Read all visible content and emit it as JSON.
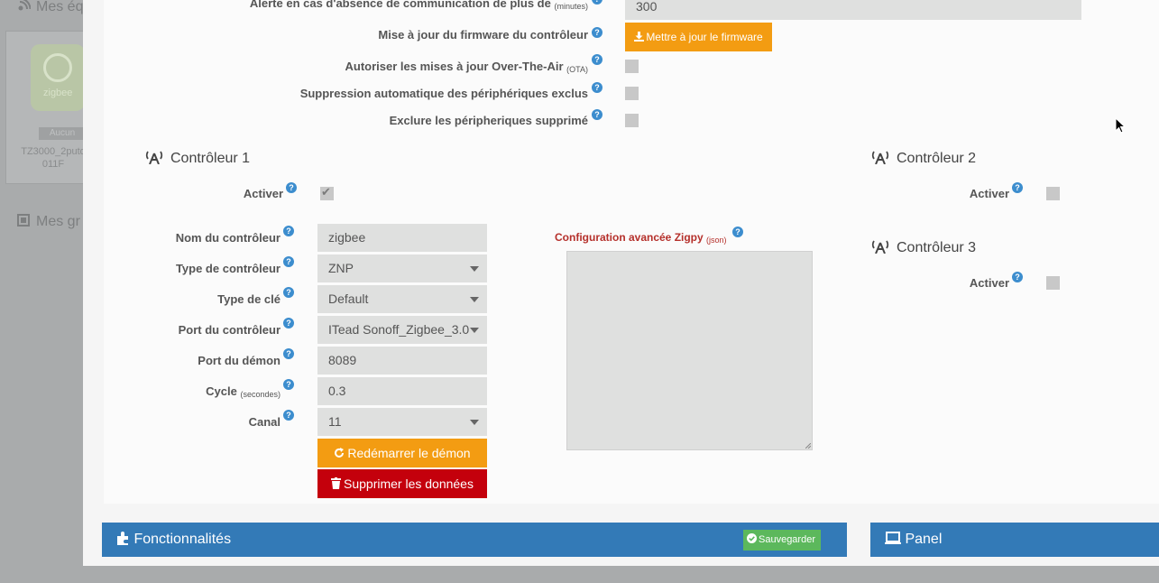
{
  "background": {
    "section1_title": "Mes éq",
    "section2_title": "Mes gr",
    "card": {
      "badge": "Aucun",
      "name_line1": "TZ3000_2putq",
      "name_line2": "011F",
      "logo_text": "zigbee"
    }
  },
  "settings": {
    "alert_label": "Alerte en cas d'absence de communication de plus de",
    "alert_unit": "(minutes)",
    "alert_value": "300",
    "firmware_label": "Mise à jour du firmware du contrôleur",
    "firmware_button": "Mettre à jour le firmware",
    "ota_label": "Autoriser les mises à jour Over-The-Air",
    "ota_suffix": "(OTA)",
    "auto_remove_label": "Suppression automatique des périphériques exclus",
    "exclude_deleted_label": "Exclure les péripheriques supprimé"
  },
  "controller1": {
    "title": "Contrôleur 1",
    "activate_label": "Activer",
    "name_label": "Nom du contrôleur",
    "name_value": "zigbee",
    "type_label": "Type de contrôleur",
    "type_value": "ZNP",
    "key_label": "Type de clé",
    "key_value": "Default",
    "port_label": "Port du contrôleur",
    "port_value": "ITead Sonoff_Zigbee_3.0",
    "daemon_port_label": "Port du démon",
    "daemon_port_value": "8089",
    "cycle_label": "Cycle",
    "cycle_unit": "(secondes)",
    "cycle_value": "0.3",
    "channel_label": "Canal",
    "channel_value": "11",
    "restart_button": "Redémarrer le démon",
    "delete_button": "Supprimer les données",
    "advanced_label": "Configuration avancée Zigpy",
    "advanced_unit": "(json)"
  },
  "controller2": {
    "title": "Contrôleur 2",
    "activate_label": "Activer"
  },
  "controller3": {
    "title": "Contrôleur 3",
    "activate_label": "Activer"
  },
  "footer": {
    "features_label": "Fonctionnalités",
    "save_label": "Sauvegarder",
    "panel_label": "Panel"
  },
  "colors": {
    "primary": "#337ab7",
    "orange": "#f39c12",
    "red": "#c4000c",
    "green": "#5cb85c",
    "help": "#3c8dce"
  }
}
